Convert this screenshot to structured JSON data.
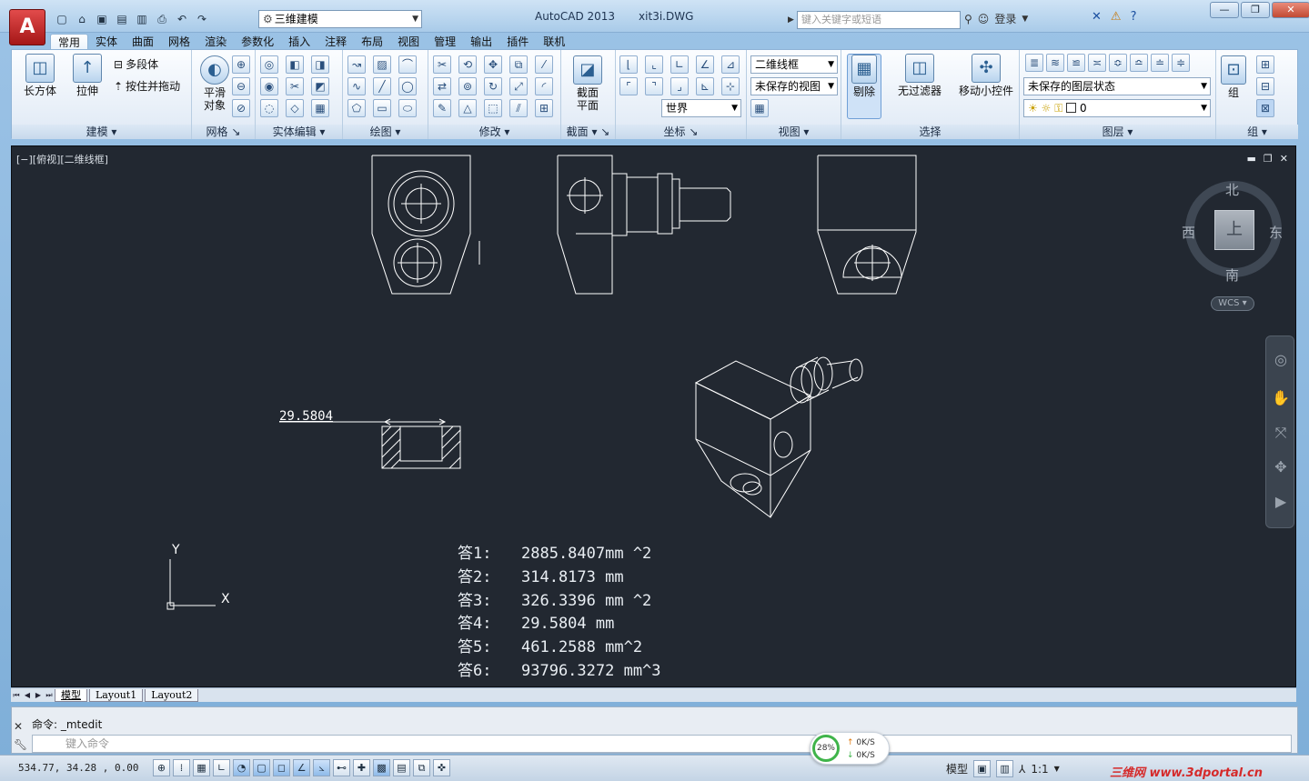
{
  "window": {
    "app_name": "AutoCAD 2013",
    "file_name": "xit3i.DWG",
    "workspace": "三维建模",
    "search_placeholder": "键入关键字或短语",
    "login": "登录",
    "app_logo": "A"
  },
  "tabs": [
    "常用",
    "实体",
    "曲面",
    "网格",
    "渲染",
    "参数化",
    "插入",
    "注释",
    "布局",
    "视图",
    "管理",
    "输出",
    "插件",
    "联机"
  ],
  "ribbon": {
    "modeling": {
      "title": "建模",
      "box": "长方体",
      "extrude": "拉伸",
      "polysolid": "多段体",
      "presspull": "按住并拖动"
    },
    "mesh": {
      "title": "网格",
      "smooth_line1": "平滑",
      "smooth_line2": "对象"
    },
    "solid_edit": {
      "title": "实体编辑"
    },
    "draw": {
      "title": "绘图"
    },
    "modify": {
      "title": "修改"
    },
    "section": {
      "title": "截面",
      "plane_line1": "截面",
      "plane_line2": "平面"
    },
    "coords": {
      "title": "坐标",
      "world": "世界"
    },
    "view": {
      "title": "视图",
      "visual_style": "二维线框",
      "saved_view": "未保存的视图"
    },
    "select": {
      "title": "选择",
      "cull": "剔除",
      "no_filter": "无过滤器",
      "gizmo": "移动小控件"
    },
    "layers": {
      "title": "图层",
      "state": "未保存的图层状态",
      "current": "0"
    },
    "groups": {
      "title": "组",
      "group": "组"
    }
  },
  "viewport": {
    "label": "[−][俯视][二维线框]",
    "dimension": "29.5804",
    "viewcube": {
      "top": "上",
      "north": "北",
      "south": "南",
      "east": "东",
      "west": "西",
      "wcs": "WCS"
    },
    "ucs": {
      "x": "X",
      "y": "Y"
    }
  },
  "answers": [
    {
      "label": "答1:",
      "value": "2885.8407mm ^2"
    },
    {
      "label": "答2:",
      "value": "314.8173 mm"
    },
    {
      "label": "答3:",
      "value": "326.3396 mm ^2"
    },
    {
      "label": "答4:",
      "value": "29.5804 mm"
    },
    {
      "label": "答5:",
      "value": "461.2588 mm^2"
    },
    {
      "label": "答6:",
      "value": "93796.3272 mm^3"
    }
  ],
  "layout_tabs": [
    "模型",
    "Layout1",
    "Layout2"
  ],
  "command": {
    "history": "命令: _mtedit",
    "placeholder": "键入命令"
  },
  "status": {
    "coords": "534.77, 34.28 , 0.00",
    "model": "模型",
    "scale": "1:1",
    "net_percent": "28%",
    "net_up": "0K/S",
    "net_down": "0K/S",
    "watermark": "三维网 www.3dportal.cn"
  }
}
